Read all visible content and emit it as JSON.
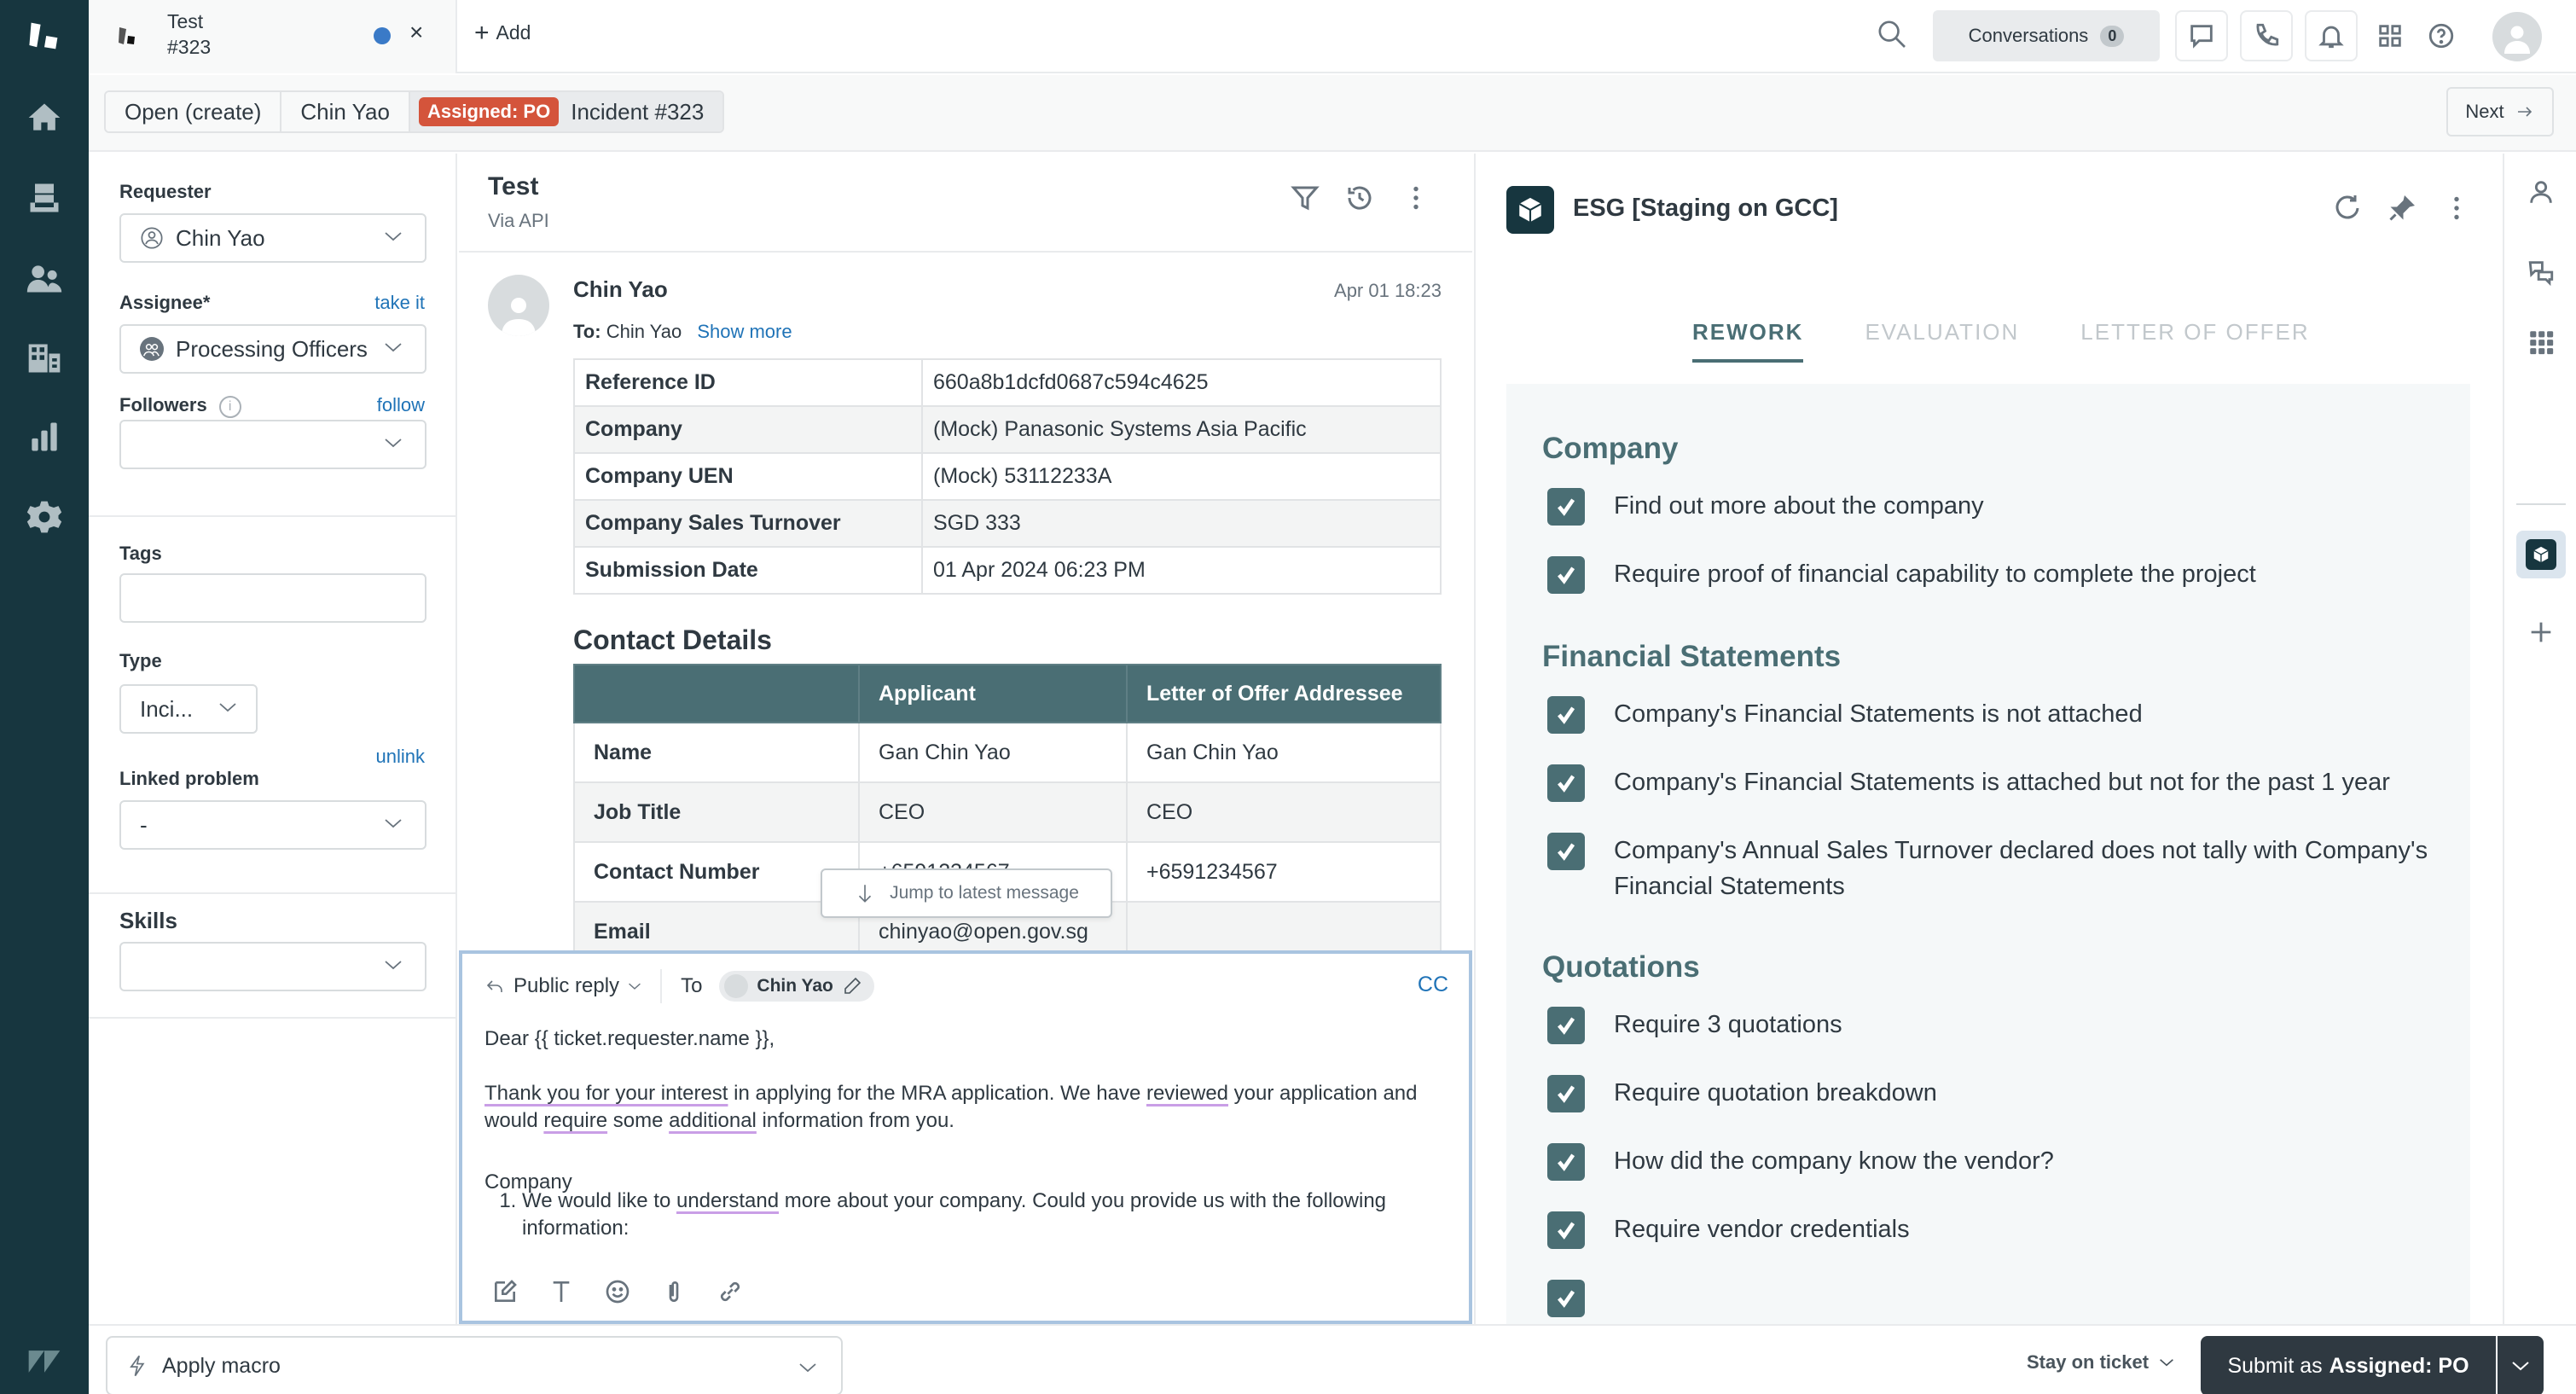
{
  "app": {
    "ticket_tab": {
      "title": "Test",
      "subtitle": "#323",
      "close": "×"
    },
    "add_tab_label": "Add"
  },
  "topbar": {
    "conversations_label": "Conversations",
    "conversations_count": "0"
  },
  "breadcrumb": {
    "items": [
      "Open (create)",
      "Chin Yao"
    ],
    "status_badge": "Assigned: PO",
    "current": "Incident #323",
    "next_label": "Next"
  },
  "properties": {
    "requester": {
      "label": "Requester",
      "value": "Chin Yao"
    },
    "assignee": {
      "label": "Assignee*",
      "action": "take it",
      "value": "Processing Officers"
    },
    "followers": {
      "label": "Followers",
      "action": "follow",
      "value": ""
    },
    "tags": {
      "label": "Tags",
      "value": ""
    },
    "type": {
      "label": "Type",
      "value": "Inci..."
    },
    "linked_problem": {
      "label": "Linked problem",
      "action": "unlink",
      "value": "-"
    },
    "skills": {
      "label": "Skills",
      "value": ""
    }
  },
  "conversation": {
    "title": "Test",
    "via": "Via API",
    "message": {
      "author": "Chin Yao",
      "time": "Apr 01 18:23",
      "to_label": "To:",
      "to_value": "Chin Yao",
      "show_more": "Show more",
      "details": [
        {
          "key": "Reference ID",
          "value": "660a8b1dcfd0687c594c4625"
        },
        {
          "key": "Company",
          "value": "(Mock) Panasonic Systems Asia Pacific"
        },
        {
          "key": "Company UEN",
          "value": "(Mock) 53112233A"
        },
        {
          "key": "Company Sales Turnover",
          "value": "SGD 333"
        },
        {
          "key": "Submission Date",
          "value": "01 Apr 2024 06:23 PM"
        }
      ],
      "contact_title": "Contact Details",
      "contact_headers": [
        "",
        "Applicant",
        "Letter of Offer Addressee"
      ],
      "contact_rows": [
        {
          "key": "Name",
          "applicant": "Gan Chin Yao",
          "addressee": "Gan Chin Yao"
        },
        {
          "key": "Job Title",
          "applicant": "CEO",
          "addressee": "CEO"
        },
        {
          "key": "Contact Number",
          "applicant": "+6591234567",
          "addressee": "+6591234567"
        },
        {
          "key": "Email",
          "applicant": "chinyao@open.gov.sg",
          "addressee": ""
        }
      ]
    },
    "jump_label": "Jump to latest message"
  },
  "composer": {
    "mode": "Public reply",
    "to_label": "To",
    "to_recipient": "Chin Yao",
    "cc_label": "CC",
    "body": {
      "greeting": "Dear {{ ticket.requester.name }},",
      "para1_a": "Thank you for your interest",
      "para1_b": " in applying for the MRA application. We have ",
      "para1_c": "reviewed",
      "para1_d": " your application and would ",
      "para1_e": "require",
      "para1_f": " some ",
      "para1_g": "additional",
      "para1_h": " information from you.",
      "section": "Company",
      "item1_a": "We would like to ",
      "item1_b": "understand",
      "item1_c": " more about your company. Could you provide us with the following information:"
    }
  },
  "app_panel": {
    "title": "ESG [Staging on GCC]",
    "tabs": [
      {
        "label": "REWORK",
        "active": true
      },
      {
        "label": "EVALUATION",
        "active": false
      },
      {
        "label": "LETTER OF OFFER",
        "active": false
      }
    ],
    "sections": [
      {
        "title": "Company",
        "items": [
          {
            "label": "Find out more about the company",
            "checked": true
          },
          {
            "label": "Require proof of financial capability to complete the project",
            "checked": true
          }
        ]
      },
      {
        "title": "Financial Statements",
        "items": [
          {
            "label": "Company's Financial Statements is not attached",
            "checked": true
          },
          {
            "label": "Company's Financial Statements is attached but not for the past 1 year",
            "checked": true
          },
          {
            "label": "Company's Annual Sales Turnover declared does not tally with Company's Financial Statements",
            "checked": true
          }
        ]
      },
      {
        "title": "Quotations",
        "items": [
          {
            "label": "Require 3 quotations",
            "checked": true
          },
          {
            "label": "Require quotation breakdown",
            "checked": true
          },
          {
            "label": "How did the company know the vendor?",
            "checked": true
          },
          {
            "label": "Require vendor credentials",
            "checked": true
          },
          {
            "label": "",
            "checked": true
          }
        ]
      }
    ]
  },
  "footer": {
    "macro_label": "Apply macro",
    "stay_label": "Stay on ticket",
    "submit_prefix": "Submit as",
    "submit_status": "Assigned: PO"
  },
  "colors": {
    "nav_bg": "#17363f",
    "accent": "#4a6e74",
    "status_badge": "#d4543b",
    "link": "#1f73b7",
    "submit_bg": "#2f3941"
  }
}
